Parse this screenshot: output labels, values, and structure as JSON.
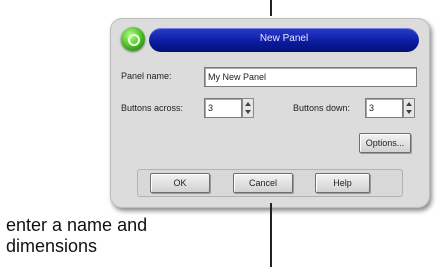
{
  "dialog": {
    "title": "New Panel",
    "panel_name_label": "Panel name:",
    "panel_name_value": "My New Panel",
    "buttons_across_label": "Buttons across:",
    "buttons_across_value": "3",
    "buttons_down_label": "Buttons down:",
    "buttons_down_value": "3",
    "options_button": "Options...",
    "ok_button": "OK",
    "cancel_button": "Cancel",
    "help_button": "Help"
  },
  "caption": {
    "line1": "enter a name and",
    "line2": "dimensions"
  }
}
